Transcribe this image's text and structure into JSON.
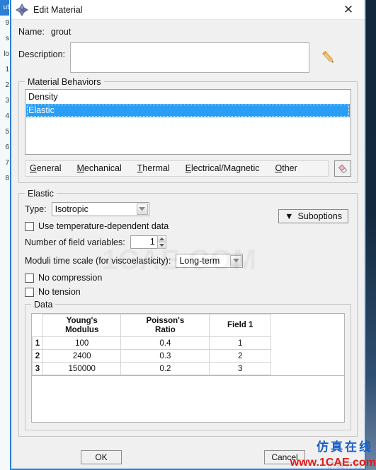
{
  "window": {
    "title": "Edit Material",
    "icon": "abaqus-diamond-icon",
    "close_icon": "✕"
  },
  "form": {
    "name_label": "Name:",
    "name_value": "grout",
    "description_label": "Description:",
    "description_value": "",
    "description_placeholder": "",
    "edit_description_icon": "pencil-icon"
  },
  "material_behaviors": {
    "legend": "Material Behaviors",
    "items": [
      {
        "label": "Density",
        "selected": false
      },
      {
        "label": "Elastic",
        "selected": true
      }
    ],
    "delete_icon": "eraser-icon",
    "menus": [
      {
        "mnemonic": "G",
        "rest": "eneral"
      },
      {
        "mnemonic": "M",
        "rest": "echanical"
      },
      {
        "mnemonic": "T",
        "rest": "hermal"
      },
      {
        "mnemonic": "E",
        "rest": "lectrical/Magnetic"
      },
      {
        "mnemonic": "O",
        "rest": "ther"
      }
    ]
  },
  "elastic": {
    "legend": "Elastic",
    "type_label": "Type:",
    "type_value": "Isotropic",
    "suboptions_label": "Suboptions",
    "suboptions_arrow": "▼",
    "use_temp_dependent_label": "Use temperature-dependent data",
    "use_temp_dependent_checked": false,
    "num_field_vars_label": "Number of field variables:",
    "num_field_vars_value": "1",
    "moduli_label": "Moduli time scale (for viscoelasticity):",
    "moduli_value": "Long-term",
    "no_compression_label": "No compression",
    "no_compression_checked": false,
    "no_tension_label": "No tension",
    "no_tension_checked": false
  },
  "data_table": {
    "legend": "Data",
    "columns": [
      "Young's\nModulus",
      "Poisson's\nRatio",
      "Field 1"
    ],
    "columns_display": [
      {
        "line1": "Young's",
        "line2": "Modulus"
      },
      {
        "line1": "Poisson's",
        "line2": "Ratio"
      },
      {
        "line1": "Field 1",
        "line2": ""
      }
    ],
    "rows": [
      {
        "number": "1",
        "youngs_modulus": "100",
        "poissons_ratio": "0.4",
        "field_1": "1"
      },
      {
        "number": "2",
        "youngs_modulus": "2400",
        "poissons_ratio": "0.3",
        "field_1": "2"
      },
      {
        "number": "3",
        "youngs_modulus": "150000",
        "poissons_ratio": "0.2",
        "field_1": "3"
      }
    ]
  },
  "footer": {
    "ok_label": "OK",
    "cancel_label": "Cancel"
  },
  "watermarks": {
    "center": "1CAE.COM",
    "chinese": "仿真在线",
    "url": "www.1CAE.com"
  },
  "background": {
    "line_numbers": [
      "ut",
      "9",
      "s",
      "lo",
      "1",
      "2",
      "3",
      "4",
      "5",
      "6",
      "7",
      "8"
    ],
    "selected_line_index": 0
  },
  "colors": {
    "accent": "#2a7fd4",
    "selection": "#2a9df4",
    "dialog_bg": "#f0f0f0",
    "mesh_green": "#3fae99",
    "watermark_red": "#e01b1b",
    "watermark_blue": "#1a5fc8"
  }
}
